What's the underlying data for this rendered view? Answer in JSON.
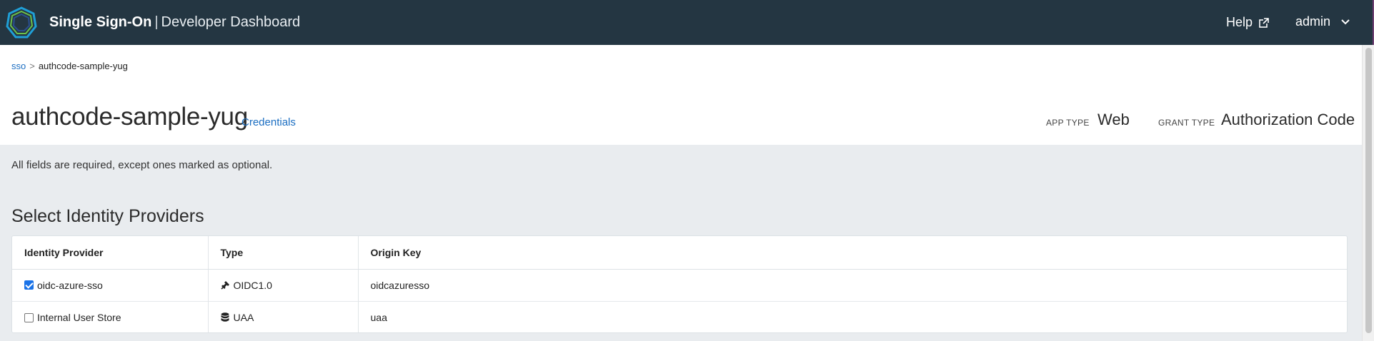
{
  "topbar": {
    "brand_primary": "Single Sign-On",
    "brand_separator": "|",
    "brand_secondary": "Developer Dashboard",
    "help_label": "Help",
    "user_label": "admin"
  },
  "breadcrumb": {
    "root": "sso",
    "separator": ">",
    "current": "authcode-sample-yug"
  },
  "app": {
    "title": "authcode-sample-yug",
    "credentials_link": "Credentials",
    "app_type_label": "APP TYPE",
    "app_type_value": "Web",
    "grant_type_label": "GRANT TYPE",
    "grant_type_value": "Authorization Code"
  },
  "form": {
    "hint": "All fields are required, except ones marked as optional.",
    "section_title": "Select Identity Providers"
  },
  "providers_table": {
    "columns": [
      "Identity Provider",
      "Type",
      "Origin Key"
    ],
    "rows": [
      {
        "name": "oidc-azure-sso",
        "checked": true,
        "type_icon": "plug-icon",
        "type": "OIDC1.0",
        "origin_key": "oidcazuresso"
      },
      {
        "name": "Internal User Store",
        "checked": false,
        "type_icon": "database-icon",
        "type": "UAA",
        "origin_key": "uaa"
      }
    ]
  },
  "colors": {
    "topbar_bg": "#243642",
    "link": "#1b6ec2",
    "page_bg": "#e9ecef",
    "checkbox_checked": "#1a73e8",
    "logo_outer": "#1f9fd6",
    "logo_inner": "#6cc04a"
  }
}
